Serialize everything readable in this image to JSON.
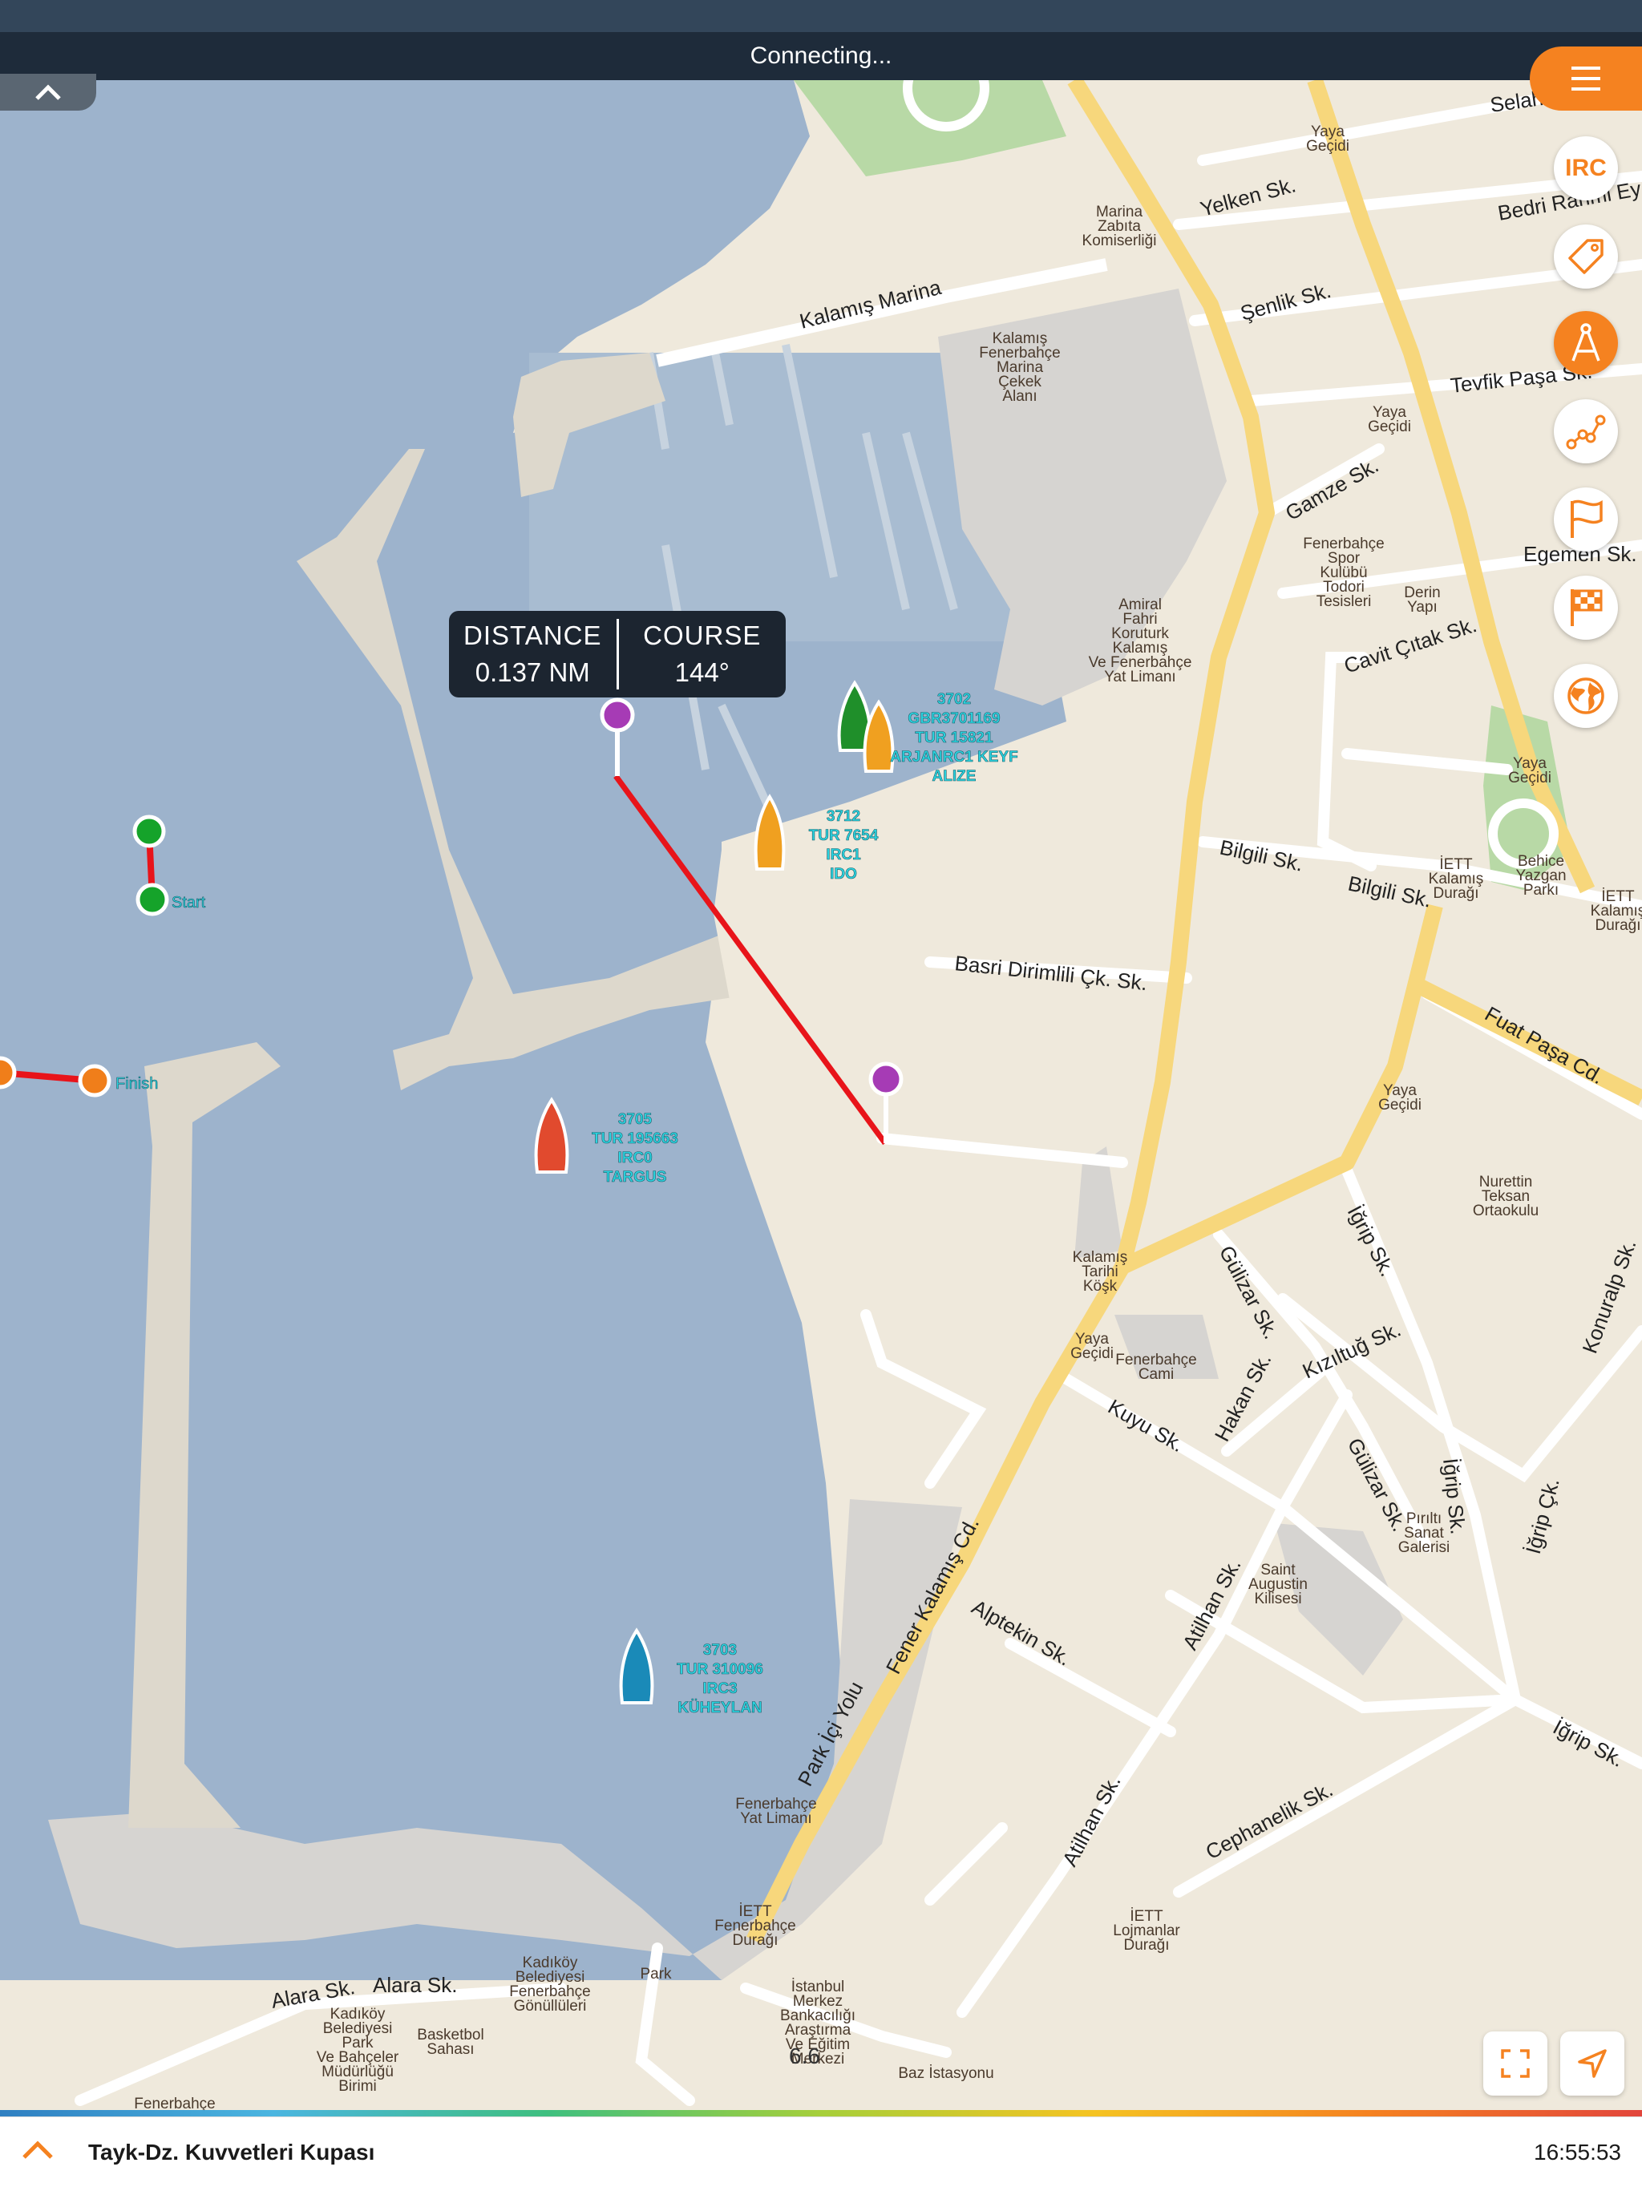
{
  "status": {
    "connecting_text": "Connecting..."
  },
  "measure": {
    "distance_label": "DISTANCE",
    "distance_value": "0.137 NM",
    "course_label": "COURSE",
    "course_value": "144°"
  },
  "side_buttons": [
    {
      "name": "irc-filter-button",
      "label": "IRC",
      "icon": "irc-text"
    },
    {
      "name": "tag-button",
      "icon": "tag-icon"
    },
    {
      "name": "measure-tool-button",
      "icon": "compass-divider-icon",
      "active": true
    },
    {
      "name": "track-button",
      "icon": "route-dots-icon"
    },
    {
      "name": "mark-flag-button",
      "icon": "flag-icon"
    },
    {
      "name": "finish-flag-button",
      "icon": "checkered-flag-icon"
    },
    {
      "name": "globe-button",
      "icon": "globe-icon"
    }
  ],
  "boats": [
    {
      "color": "#1f8f2a",
      "lines": [
        "3702",
        "GBR3701169",
        "TUR 15821",
        "ARJANRC1 KEYF",
        "ALIZE"
      ]
    },
    {
      "color": "#f0a020",
      "lines": [
        "3712",
        "TUR 7654",
        "IRC1",
        "IDO"
      ]
    },
    {
      "color": "#e14a2e",
      "lines": [
        "3705",
        "TUR 195663",
        "IRC0",
        "TARGUS"
      ]
    },
    {
      "color": "#1a8ab8",
      "lines": [
        "3703",
        "TUR 310096",
        "IRC3",
        "KÜHEYLAN"
      ]
    }
  ],
  "course_marks": {
    "start_label": "Start",
    "finish_label": "Finish"
  },
  "streets": [
    "Selahattin",
    "Bedri Rahmi Ey",
    "Yelken Sk.",
    "Şenlik Sk.",
    "Tevfik Paşa Sk.",
    "Gamze Sk.",
    "Egemen Sk.",
    "Cavit Çıtak Sk.",
    "Bilgili Sk.",
    "Bilgili Sk.",
    "Basri Dirimlili Çk. Sk.",
    "Fuat Paşa Cd.",
    "Kalamış Marina",
    "Fener Kalamış Cd.",
    "Park İçi Yolu",
    "Alptekin Sk.",
    "Kuyu Sk.",
    "Hakan Sk.",
    "Kızıltuğ Sk.",
    "Gülizar Sk.",
    "Gülizar Sk.",
    "İğrip Sk.",
    "İğrip Sk.",
    "İğrip Sk.",
    "İğrip Çk.",
    "Konuralp Sk.",
    "Atilhan Sk.",
    "Atilhan Sk.",
    "Cephanelik Sk.",
    "Alara Sk.",
    "Alara Sk."
  ],
  "pois": [
    {
      "lines": [
        "Yaya",
        "Geçidi"
      ]
    },
    {
      "lines": [
        "Marina",
        "Zabıta",
        "Komiserliği"
      ]
    },
    {
      "lines": [
        "Kalamış",
        "Fenerbahçe",
        "Marina",
        "Çekek",
        "Alanı"
      ]
    },
    {
      "lines": [
        "Yaya",
        "Geçidi"
      ]
    },
    {
      "lines": [
        "Fenerbahçe",
        "Spor",
        "Kulübü",
        "Todori",
        "Tesisleri"
      ]
    },
    {
      "lines": [
        "Derin",
        "Yapı"
      ]
    },
    {
      "lines": [
        "Amiral",
        "Fahri",
        "Koruturk",
        "Kalamış",
        "Ve Fenerbahçe",
        "Yat Limanı"
      ]
    },
    {
      "lines": [
        "Yaya",
        "Geçidi"
      ]
    },
    {
      "lines": [
        "İETT",
        "Kalamış",
        "Durağı"
      ]
    },
    {
      "lines": [
        "Behice",
        "Yazgan",
        "Parkı"
      ]
    },
    {
      "lines": [
        "İETT",
        "Kalamış",
        "Durağı"
      ]
    },
    {
      "lines": [
        "Yaya",
        "Geçidi"
      ]
    },
    {
      "lines": [
        "Nurettin",
        "Teksan",
        "Ortaokulu"
      ]
    },
    {
      "lines": [
        "Kalamış",
        "Tarihi",
        "Köşk"
      ]
    },
    {
      "lines": [
        "Yaya",
        "Geçidi"
      ]
    },
    {
      "lines": [
        "Fenerbahçe",
        "Cami"
      ]
    },
    {
      "lines": [
        "Pırıltı",
        "Sanat",
        "Galerisi"
      ]
    },
    {
      "lines": [
        "Saint",
        "Augustin",
        "Kilisesi"
      ]
    },
    {
      "lines": [
        "Fenerbahçe",
        "Yat Limanı"
      ]
    },
    {
      "lines": [
        "İETT",
        "Fenerbahçe",
        "Durağı"
      ]
    },
    {
      "lines": [
        "İETT",
        "Lojmanlar",
        "Durağı"
      ]
    },
    {
      "lines": [
        "Kadıköy",
        "Belediyesi",
        "Fenerbahçe",
        "Gönüllüleri"
      ]
    },
    {
      "lines": [
        "Park"
      ]
    },
    {
      "lines": [
        "İstanbul",
        "Merkez",
        "Bankacılığı",
        "Araştırma",
        "Ve Eğitim",
        "Merkezi"
      ]
    },
    {
      "lines": [
        "Baz İstasyonu"
      ]
    },
    {
      "lines": [
        "Kadıköy",
        "Belediyesi",
        "Park",
        "Ve Bahçeler",
        "Müdürlüğü",
        "Birimi"
      ]
    },
    {
      "lines": [
        "Basketbol",
        "Sahası"
      ]
    },
    {
      "lines": [
        "Fenerbahçe"
      ]
    }
  ],
  "map_number": "6.6",
  "footer": {
    "race_title": "Tayk-Dz. Kuvvetleri Kupası",
    "time": "16:55:53"
  },
  "colors": {
    "water": "#9db3cc",
    "land": "#efe9dc",
    "pier": "#ddd8cc",
    "harbor": "#d8d6d2",
    "park": "#b8d9a6",
    "road_major": "#f7d77c",
    "accent": "#f58220",
    "route_line": "#e8141a",
    "pin": "#a63bb5",
    "start_mark": "#15a32a",
    "finish_mark": "#f07e1a",
    "boat_label": "#2ad4e0"
  }
}
